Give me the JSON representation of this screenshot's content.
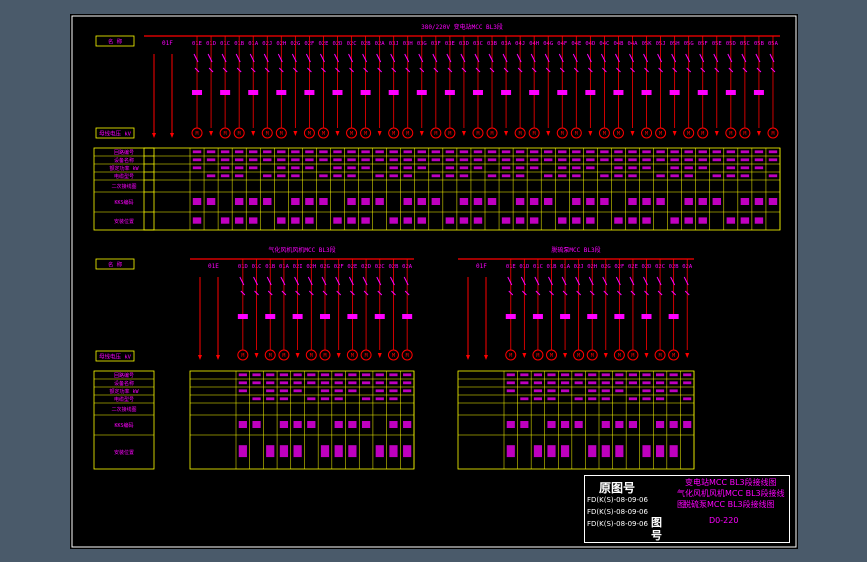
{
  "top_panel": {
    "header": "380/220V 变电站MCC BL3段",
    "left_id": "01F",
    "circuits": [
      "01E",
      "01D",
      "01C",
      "01B",
      "01A",
      "02J",
      "02H",
      "02G",
      "02F",
      "02E",
      "02D",
      "02C",
      "02B",
      "02A",
      "03J",
      "03H",
      "03G",
      "03F",
      "03E",
      "03D",
      "03C",
      "03B",
      "03A",
      "04J",
      "04H",
      "04G",
      "04F",
      "04E",
      "04D",
      "04C",
      "04B",
      "04A",
      "05K",
      "05J",
      "05H",
      "05G",
      "05F",
      "05E",
      "05D",
      "05C",
      "05B",
      "05A"
    ]
  },
  "bottom_left": {
    "header": "气化风机风机MCC BL3段",
    "left_id": "01E",
    "circuits": [
      "01D",
      "01C",
      "01B",
      "01A",
      "02I",
      "02H",
      "02G",
      "02F",
      "02E",
      "02D",
      "02C",
      "02B",
      "02A"
    ]
  },
  "bottom_right": {
    "header": "脱硫泵MCC BL3段",
    "left_id": "01F",
    "circuits": [
      "01E",
      "01D",
      "01C",
      "01B",
      "01A",
      "02J",
      "02H",
      "02G",
      "02F",
      "02E",
      "02D",
      "02C",
      "02B",
      "02A"
    ]
  },
  "row_labels": [
    "回路编号",
    "设备名称",
    "额定功率 kW",
    "电缆型号",
    "二次接线图",
    "KKS编码",
    "安装位置"
  ],
  "short_labels": {
    "label_a": "名  称",
    "label_b": "母线电压 kV"
  },
  "title_block": {
    "original_label": "原图号",
    "title_lines": [
      "变电站MCC BL3段接线图",
      "气化风机风机MCC BL3段接线图",
      "脱硫泵MCC BL3段接线图"
    ],
    "ref_numbers": [
      "FD(K(S)-08-09-06",
      "FD(K(S)-08-09-06",
      "FD(K(S)-08-09-06"
    ],
    "drawing_label": "图号",
    "drawing_no": "D0-220"
  },
  "colors": {
    "line": "#ff00ff",
    "busbar": "#ff0000",
    "table": "#ffff00",
    "text": "#ff00ff",
    "frame": "#ffffff",
    "background": "#000000"
  }
}
